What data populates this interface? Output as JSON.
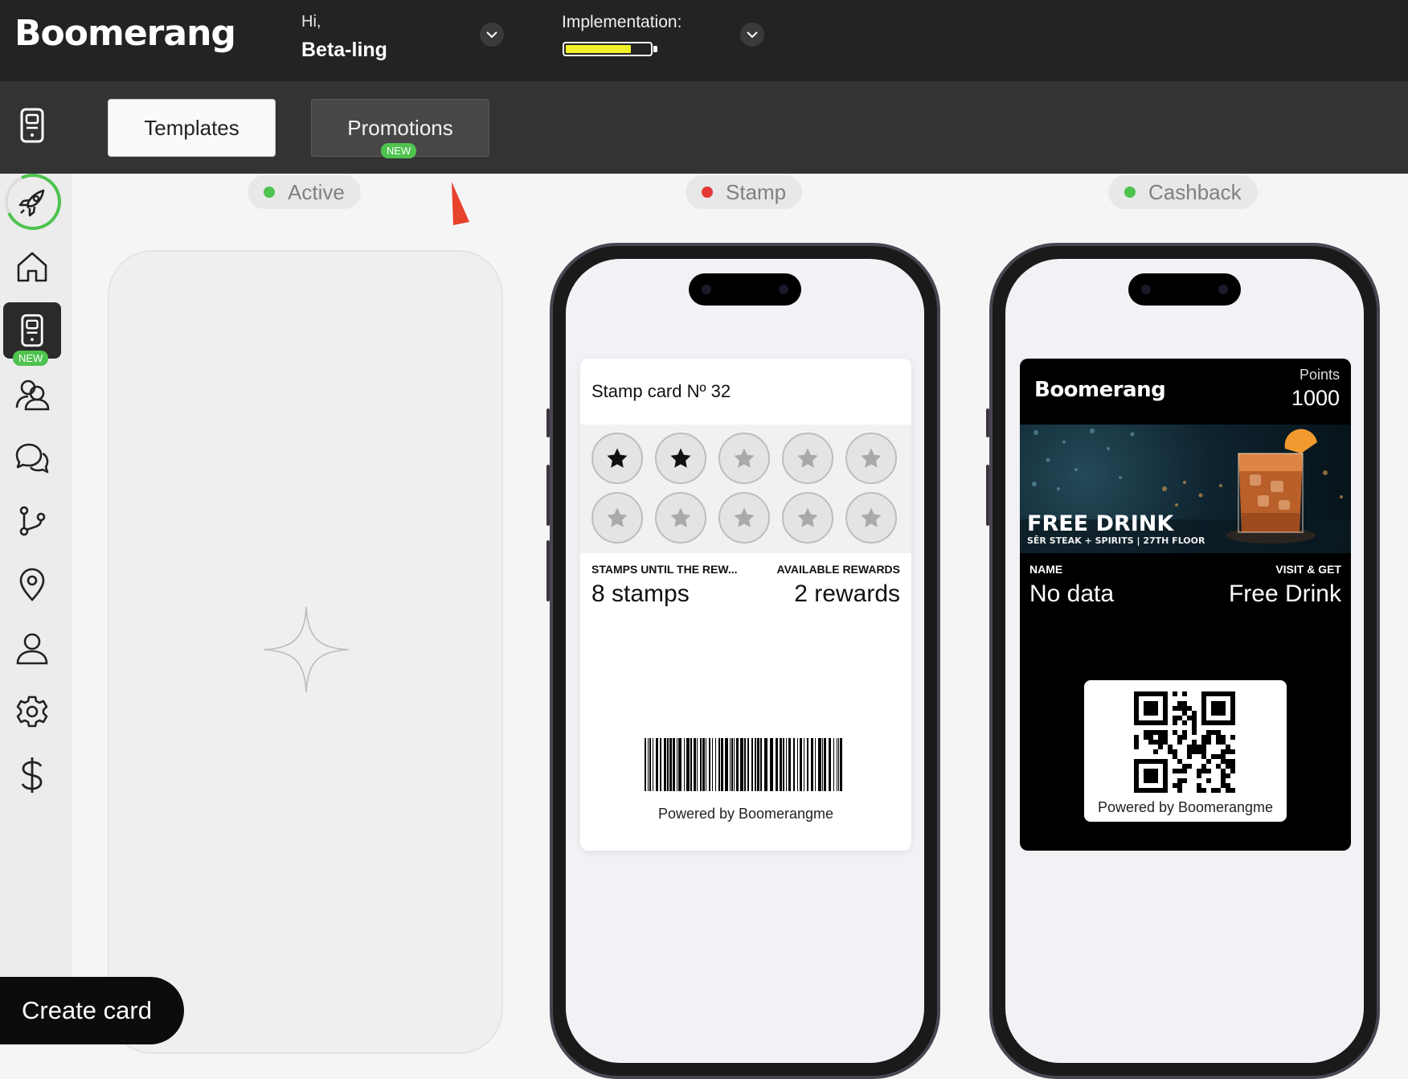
{
  "header": {
    "logo": "Boomerang",
    "greeting": "Hi,",
    "user_name": "Beta-ling",
    "implementation_label": "Implementation:",
    "implementation_progress": 0.78,
    "battery_color": "#f2f22a"
  },
  "toolbar": {
    "templates_label": "Templates",
    "promotions_label": "Promotions",
    "promotions_badge": "NEW"
  },
  "sidebar": {
    "items": [
      {
        "icon": "rocket-icon"
      },
      {
        "icon": "home-icon"
      },
      {
        "icon": "card-phone-icon",
        "badge": "NEW",
        "active": true
      },
      {
        "icon": "users-icon"
      },
      {
        "icon": "chat-icon"
      },
      {
        "icon": "branch-icon"
      },
      {
        "icon": "location-pin-icon"
      },
      {
        "icon": "user-icon"
      },
      {
        "icon": "settings-gear-icon"
      },
      {
        "icon": "dollar-icon"
      }
    ]
  },
  "columns": [
    {
      "status": "Active",
      "dot_color": "#4ec34e"
    },
    {
      "status": "Stamp",
      "dot_color": "#e53935"
    },
    {
      "status": "Cashback",
      "dot_color": "#4ec34e"
    }
  ],
  "stamp_card": {
    "title": "Stamp card Nº 32",
    "stamps_total": 10,
    "stamps_filled": 2,
    "left_label": "STAMPS UNTIL THE REW...",
    "left_value": "8 stamps",
    "right_label": "AVAILABLE REWARDS",
    "right_value": "2 rewards",
    "powered": "Powered by Boomerangme"
  },
  "cashback_card": {
    "logo": "Boomerang",
    "points_label": "Points",
    "points_value": "1000",
    "promo_title": "FREE DRINK",
    "promo_subtitle": "SĒR STEAK + SPIRITS | 27TH FLOOR",
    "left_label": "NAME",
    "left_value": "No data",
    "right_label": "VISIT & GET",
    "right_value": "Free Drink",
    "powered": "Powered by Boomerangme"
  },
  "create_button": "Create card"
}
